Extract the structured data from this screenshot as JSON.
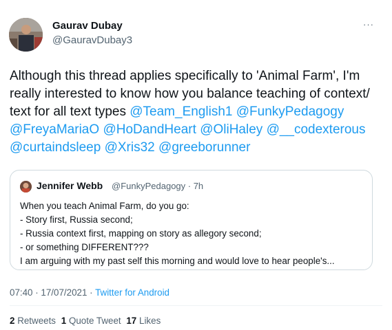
{
  "tweet": {
    "author_name": "Gaurav Dubay",
    "author_handle": "@GauravDubay3",
    "more_label": "···",
    "text_parts": {
      "p1": "Although this thread applies specifically to 'Animal Farm', I'm really interested to know how you balance teaching of context/ text for all text types ",
      "m1": "@Team_English1",
      "m2": "@FunkyPedagogy",
      "m3": "@FreyaMariaO",
      "m4": "@HoDandHeart",
      "m5": "@OliHaley",
      "m6": "@__codexterous",
      "m7": "@curtaindsleep",
      "m8": "@Xris32",
      "m9": "@greeborunner"
    },
    "time": "07:40 · 17/07/2021 · ",
    "source": "Twitter for Android",
    "stats": {
      "retweets_count": "2",
      "retweets_label": "Retweets",
      "quote_count": "1",
      "quote_label": "Quote Tweet",
      "likes_count": "17",
      "likes_label": "Likes"
    }
  },
  "quoted": {
    "author_name": "Jennifer Webb",
    "meta": "@FunkyPedagogy · 7h",
    "lines": [
      "When you teach Animal Farm, do you go:",
      "- Story first, Russia second;",
      "- Russia context first, mapping on story as allegory second;",
      "- or something DIFFERENT???",
      "I am arguing with my past self this morning and would love to hear people's..."
    ]
  }
}
